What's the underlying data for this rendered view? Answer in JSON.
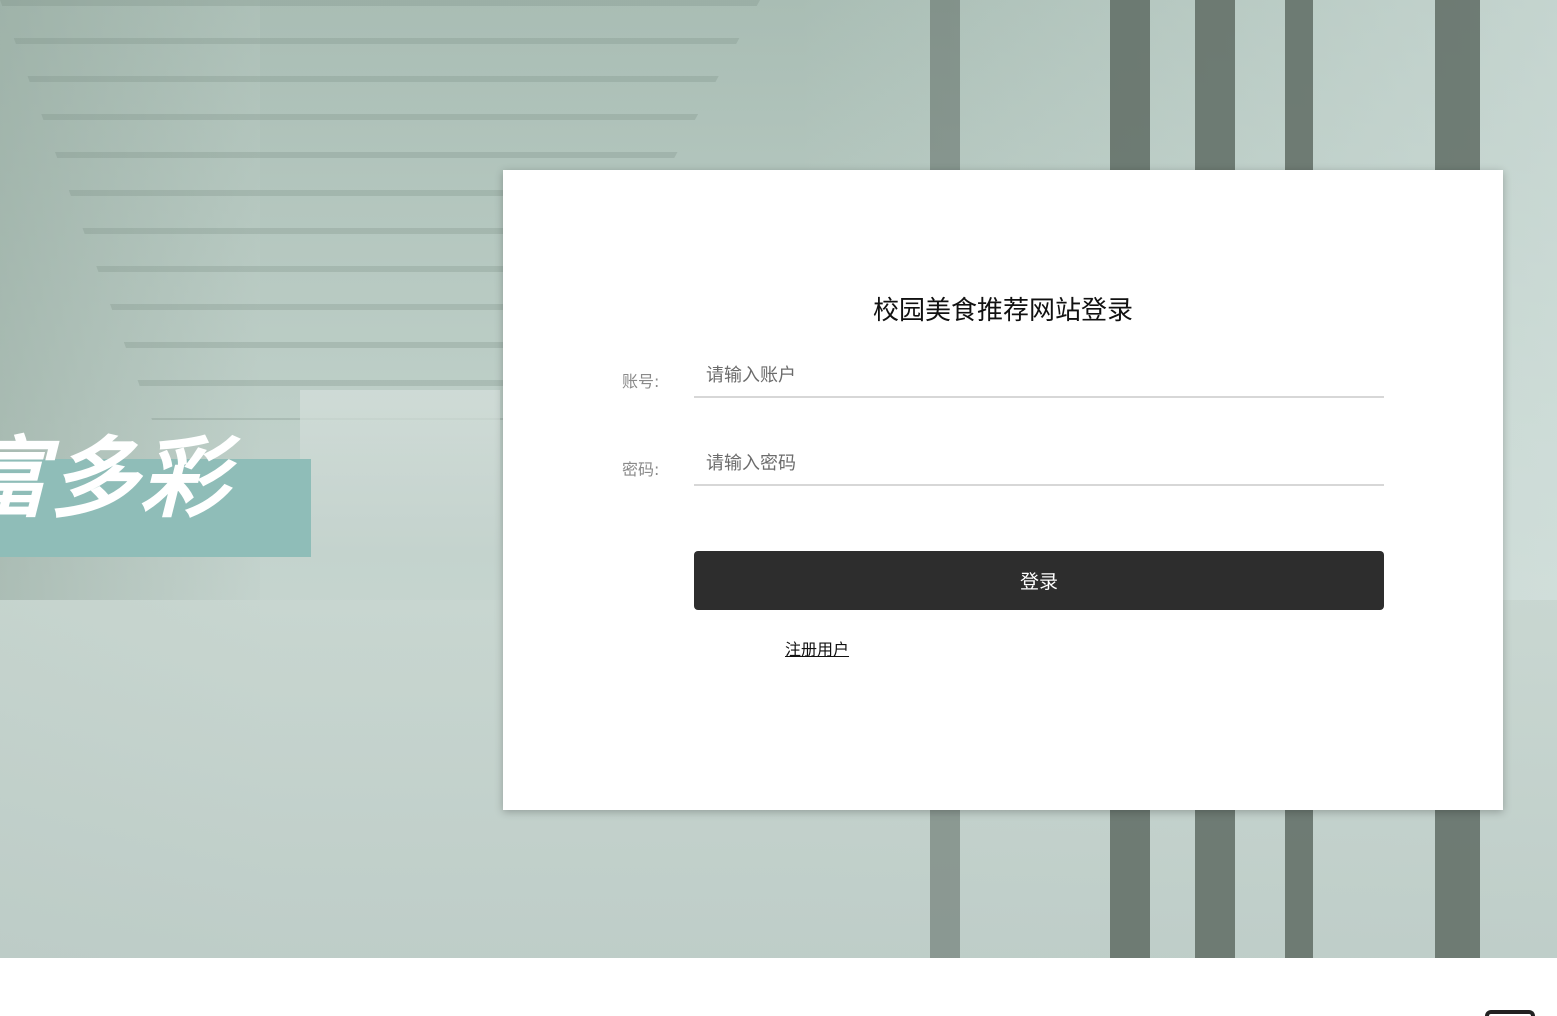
{
  "hero": {
    "banner_text": "富多彩",
    "banner_color": "#8fbdb8"
  },
  "login": {
    "title": "校园美食推荐网站登录",
    "account_label": "账号:",
    "account_placeholder": "请输入账户",
    "password_label": "密码:",
    "password_placeholder": "请输入密码",
    "login_button": "登录",
    "register_link": "注册用户",
    "button_color": "#2d2d2d"
  }
}
